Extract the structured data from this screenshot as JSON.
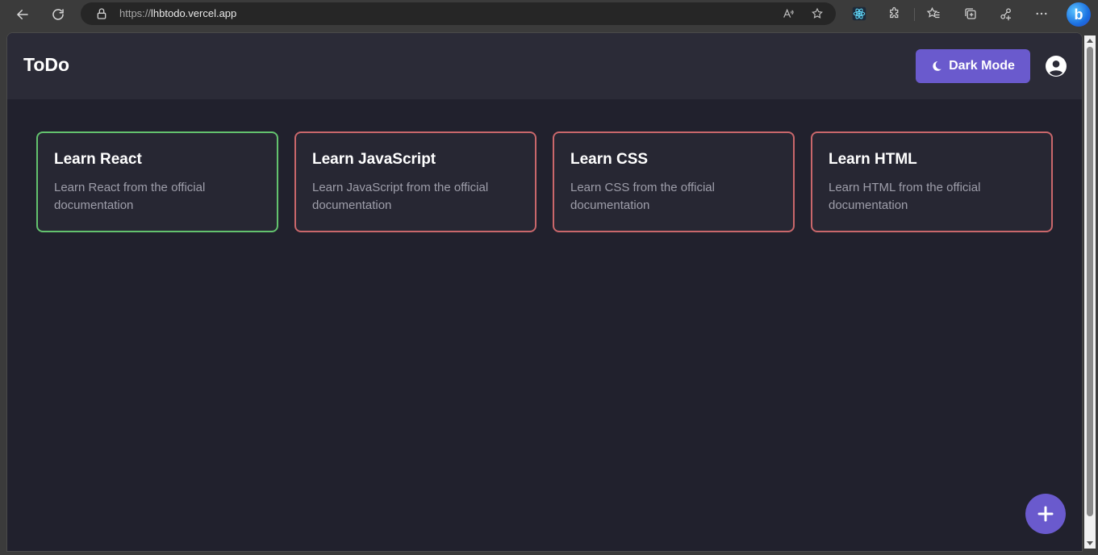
{
  "browser": {
    "url_scheme": "https://",
    "url_host": "lhbtodo.vercel.app"
  },
  "app": {
    "logo": "ToDo",
    "dark_mode_label": "Dark Mode"
  },
  "todos": [
    {
      "title": "Learn React",
      "description": "Learn React from the official documentation",
      "status": "done",
      "border_color": "#63c26e"
    },
    {
      "title": "Learn JavaScript",
      "description": "Learn JavaScript from the official documentation",
      "status": "pending",
      "border_color": "#c9676b"
    },
    {
      "title": "Learn CSS",
      "description": "Learn CSS from the official documentation",
      "status": "pending",
      "border_color": "#c9676b"
    },
    {
      "title": "Learn HTML",
      "description": "Learn HTML from the official documentation",
      "status": "pending",
      "border_color": "#c9676b"
    }
  ],
  "colors": {
    "accent": "#6a5acd",
    "background": "#21212d",
    "header": "#2b2b37"
  },
  "icons": {
    "back": "arrow-left-icon",
    "refresh": "refresh-icon",
    "lock": "lock-icon",
    "read_aloud": "read-aloud-icon",
    "add_favorite": "star-plus-icon",
    "react_devtools": "react-icon",
    "extensions": "puzzle-icon",
    "favorites": "favorites-icon",
    "collections": "collections-icon",
    "profile_share": "share-icon",
    "more": "more-icon",
    "bing": "bing-icon",
    "dark_mode": "moon-icon",
    "user": "user-circle-icon",
    "add": "plus-icon"
  }
}
